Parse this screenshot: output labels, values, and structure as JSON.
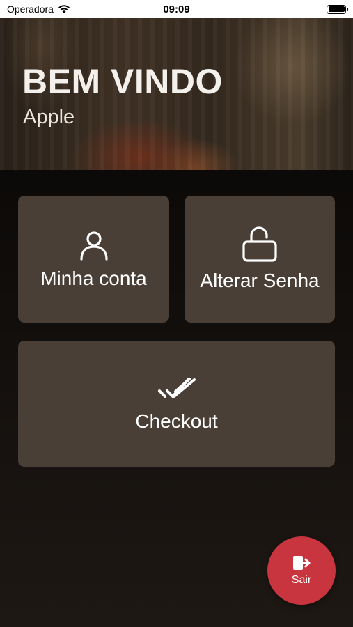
{
  "status_bar": {
    "carrier": "Operadora",
    "time": "09:09",
    "wifi_icon": "wifi-icon",
    "battery_icon": "battery-icon"
  },
  "header": {
    "title": "BEM VINDO",
    "subtitle": "Apple"
  },
  "menu": {
    "account": {
      "label": "Minha conta",
      "icon": "user-icon"
    },
    "password": {
      "label": "Alterar Senha",
      "icon": "unlock-icon"
    },
    "checkout": {
      "label": "Checkout",
      "icon": "double-check-icon"
    }
  },
  "logout": {
    "label": "Sair",
    "icon": "logout-icon"
  },
  "colors": {
    "tile_background": "#4a3f36",
    "logout_button": "#c8353f",
    "screen_background": "#0f0c0a"
  }
}
